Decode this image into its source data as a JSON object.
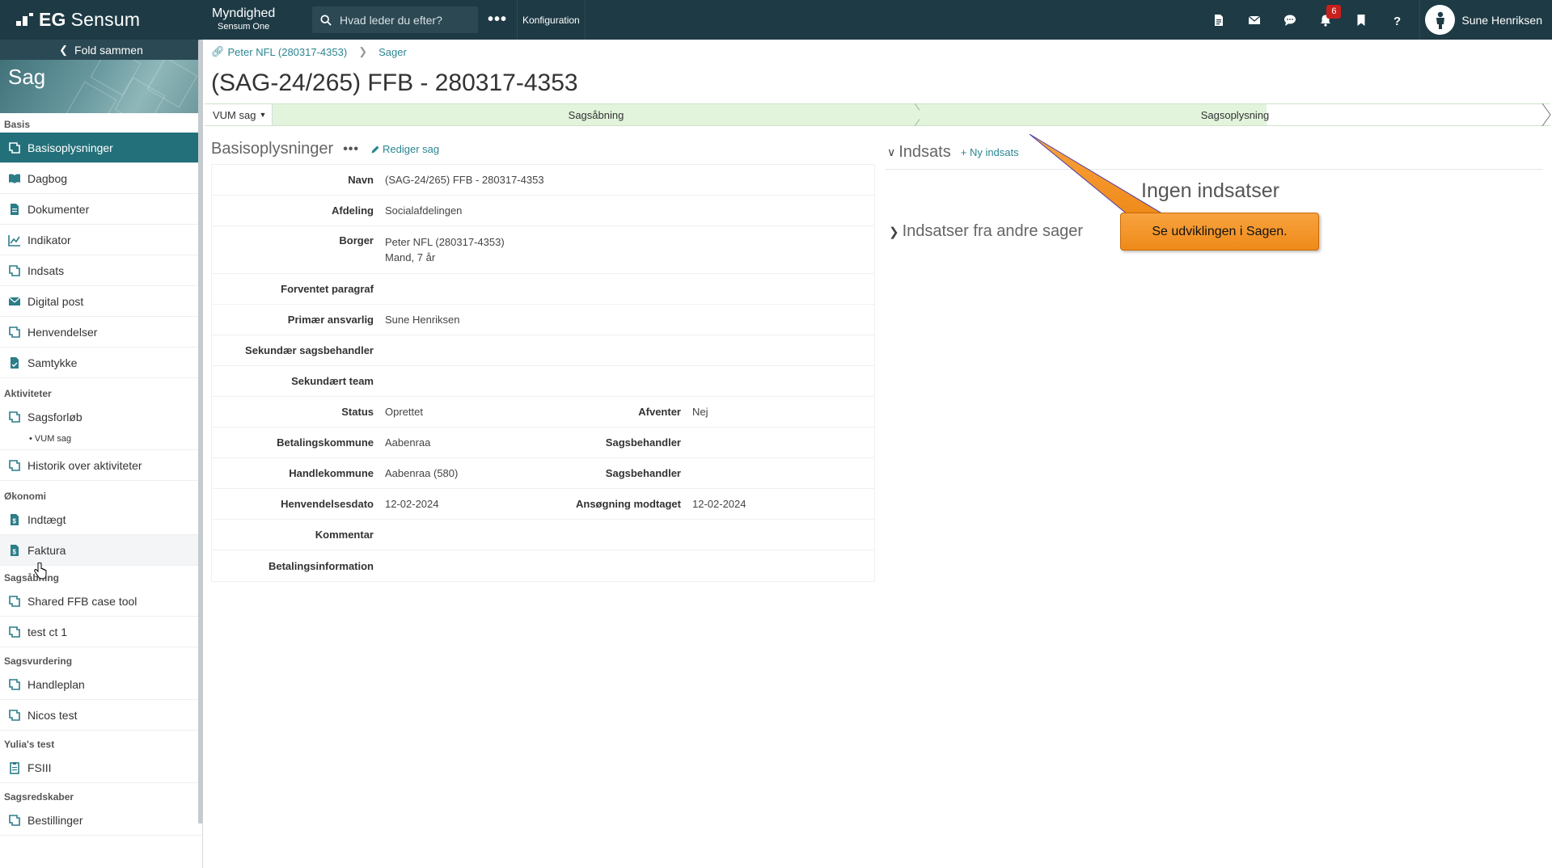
{
  "topbar": {
    "brand_bold": "EG",
    "brand_name": "Sensum",
    "app_title": "Myndighed",
    "app_subtitle": "Sensum One",
    "search_placeholder": "Hvad leder du efter?",
    "config_label": "Konfiguration",
    "notification_count": "6",
    "user_name": "Sune Henriksen",
    "icons": [
      "document-icon",
      "mail-icon",
      "chat-icon",
      "bell-icon",
      "bookmark-icon",
      "help-icon"
    ]
  },
  "sidebar": {
    "fold_label": "Fold sammen",
    "banner_title": "Sag",
    "sections": {
      "basis": "Basis",
      "aktiviteter": "Aktiviteter",
      "okonomi": "Økonomi",
      "sagsabning": "Sagsåbning",
      "sagsvurdering": "Sagsvurdering",
      "yulia": "Yulia's test",
      "sagsredskaber": "Sagsredskaber"
    },
    "items": {
      "basisoplysninger": "Basisoplysninger",
      "dagbog": "Dagbog",
      "dokumenter": "Dokumenter",
      "indikator": "Indikator",
      "indsats": "Indsats",
      "digital_post": "Digital post",
      "henvendelser": "Henvendelser",
      "samtykke": "Samtykke",
      "sagsforlob": "Sagsforløb",
      "vum_sag": "• VUM sag",
      "historik": "Historik over aktiviteter",
      "indtaegt": "Indtægt",
      "faktura": "Faktura",
      "shared_ffb": "Shared FFB case tool",
      "test_ct": "test ct 1",
      "handleplan": "Handleplan",
      "nicos_test": "Nicos test",
      "fsiii": "FSIII",
      "bestillinger": "Bestillinger"
    }
  },
  "main": {
    "breadcrumb": [
      "Peter NFL (280317-4353)",
      "Sager"
    ],
    "title": "(SAG-24/265) FFB - 280317-4353",
    "process": {
      "type_label": "VUM sag",
      "stage1": "Sagsåbning",
      "stage2": "Sagsoplysning"
    },
    "basis": {
      "title": "Basisoplysninger",
      "dots": "•••",
      "edit_label": "Rediger sag",
      "rows": {
        "navn": {
          "label": "Navn",
          "value": "(SAG-24/265) FFB - 280317-4353"
        },
        "afdeling": {
          "label": "Afdeling",
          "value": "Socialafdelingen"
        },
        "borger": {
          "label": "Borger",
          "value": "Peter NFL (280317-4353)",
          "value2": "Mand, 7 år"
        },
        "forventet": {
          "label": "Forventet paragraf",
          "value": ""
        },
        "primaer": {
          "label": "Primær ansvarlig",
          "value": "Sune Henriksen"
        },
        "sek_behandler": {
          "label": "Sekundær sagsbehandler",
          "value": ""
        },
        "sek_team": {
          "label": "Sekundært team",
          "value": ""
        },
        "status": {
          "label": "Status",
          "value": "Oprettet",
          "label2": "Afventer",
          "value2": "Nej"
        },
        "betalingskommune": {
          "label": "Betalingskommune",
          "value": "Aabenraa",
          "label2": "Sagsbehandler",
          "value2": ""
        },
        "handlekommune": {
          "label": "Handlekommune",
          "value": "Aabenraa (580)",
          "label2": "Sagsbehandler",
          "value2": ""
        },
        "henvendelsesdato": {
          "label": "Henvendelsesdato",
          "value": "12-02-2024",
          "label2": "Ansøgning modtaget",
          "value2": "12-02-2024"
        },
        "kommentar": {
          "label": "Kommentar",
          "value": ""
        },
        "betalingsinfo": {
          "label": "Betalingsinformation",
          "value": ""
        }
      }
    },
    "indsats": {
      "title": "Indsats",
      "new_label": "+ Ny indsats",
      "empty_text": "Ingen indsatser",
      "other_title": "Indsatser fra andre sager"
    },
    "callout_text": "Se udviklingen i Sagen."
  },
  "colors": {
    "topbar": "#1e3a45",
    "active_item": "#23707a",
    "link": "#2b8590",
    "stage_green": "#e2f4dc",
    "callout_orange": "#f39a30",
    "badge_red": "#c8201c"
  }
}
